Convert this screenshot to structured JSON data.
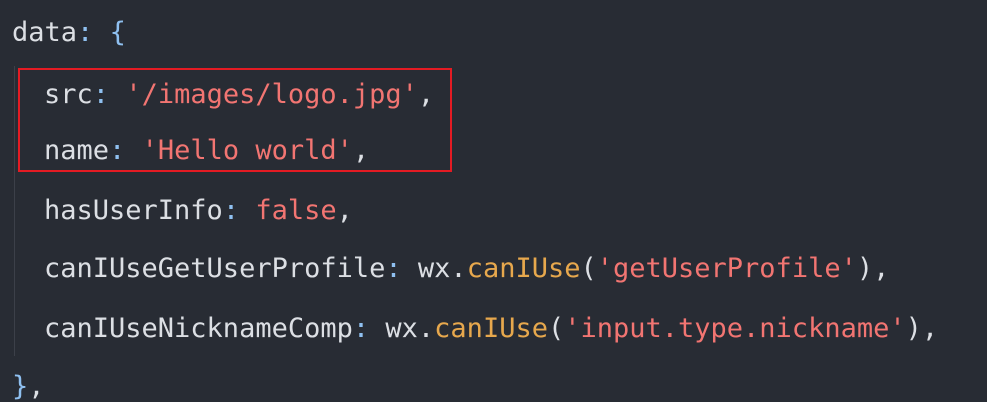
{
  "code": {
    "line0": {
      "key": "data",
      "colon": ":",
      "brace": "{"
    },
    "line1": {
      "key": "src",
      "colon": ":",
      "string": "'/images/logo.jpg'",
      "comma": ","
    },
    "line2": {
      "key": "name",
      "colon": ":",
      "string": "'Hello world'",
      "comma": ","
    },
    "line3": {
      "key": "hasUserInfo",
      "colon": ":",
      "value": "false",
      "comma": ","
    },
    "line4": {
      "key": "canIUseGetUserProfile",
      "colon": ":",
      "obj": "wx",
      "dot": ".",
      "func": "canIUse",
      "open": "(",
      "arg": "'getUserProfile'",
      "close": ")",
      "comma": ","
    },
    "line5": {
      "key": "canIUseNicknameComp",
      "colon": ":",
      "obj": "wx",
      "dot": ".",
      "func": "canIUse",
      "open": "(",
      "arg": "'input.type.nickname'",
      "close": ")",
      "comma": ","
    },
    "line6": {
      "brace": "}",
      "comma": ","
    }
  },
  "colors": {
    "background": "#282c34",
    "key": "#dcdfe4",
    "punctuation": "#8fc0f0",
    "string": "#f27572",
    "function": "#e7a84d",
    "highlight_border": "#e41b23"
  }
}
